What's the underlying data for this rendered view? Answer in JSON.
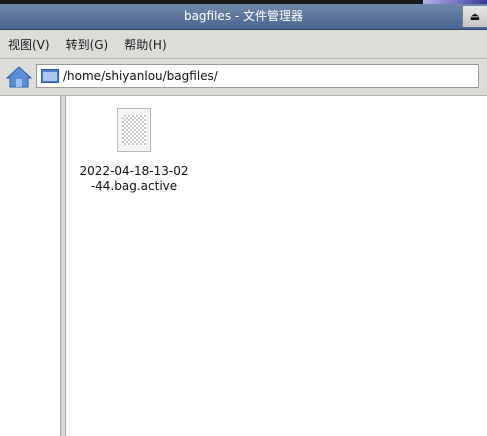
{
  "window": {
    "title": "bagfiles - 文件管理器",
    "eject_glyph": "⏏"
  },
  "menu": [
    {
      "label": "视图(V)"
    },
    {
      "label": "转到(G)"
    },
    {
      "label": "帮助(H)"
    }
  ],
  "location": {
    "path": "/home/shiyanlou/bagfiles/"
  },
  "files": [
    {
      "name": "2022-04-18-13-02\n-44.bag.active",
      "icon": "unknown-file-icon"
    }
  ],
  "colors": {
    "titlebar": "#4a6591",
    "folder_blue": "#4d80c8"
  }
}
